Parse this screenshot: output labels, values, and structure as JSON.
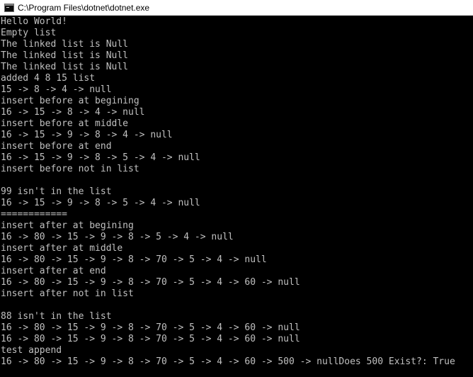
{
  "window": {
    "title": "C:\\Program Files\\dotnet\\dotnet.exe"
  },
  "console": {
    "lines": [
      "Hello World!",
      "Empty list",
      "The linked list is Null",
      "The linked list is Null",
      "The linked list is Null",
      "added 4 8 15 list",
      "15 -> 8 -> 4 -> null",
      "insert before at begining",
      "16 -> 15 -> 8 -> 4 -> null",
      "insert before at middle",
      "16 -> 15 -> 9 -> 8 -> 4 -> null",
      "insert before at end",
      "16 -> 15 -> 9 -> 8 -> 5 -> 4 -> null",
      "insert before not in list",
      "",
      "99 isn't in the list",
      "16 -> 15 -> 9 -> 8 -> 5 -> 4 -> null",
      "============",
      "insert after at begining",
      "16 -> 80 -> 15 -> 9 -> 8 -> 5 -> 4 -> null",
      "insert after at middle",
      "16 -> 80 -> 15 -> 9 -> 8 -> 70 -> 5 -> 4 -> null",
      "insert after at end",
      "16 -> 80 -> 15 -> 9 -> 8 -> 70 -> 5 -> 4 -> 60 -> null",
      "insert after not in list",
      "",
      "88 isn't in the list",
      "16 -> 80 -> 15 -> 9 -> 8 -> 70 -> 5 -> 4 -> 60 -> null",
      "16 -> 80 -> 15 -> 9 -> 8 -> 70 -> 5 -> 4 -> 60 -> null",
      "test append",
      "16 -> 80 -> 15 -> 9 -> 8 -> 70 -> 5 -> 4 -> 60 -> 500 -> nullDoes 500 Exist?: True"
    ]
  }
}
